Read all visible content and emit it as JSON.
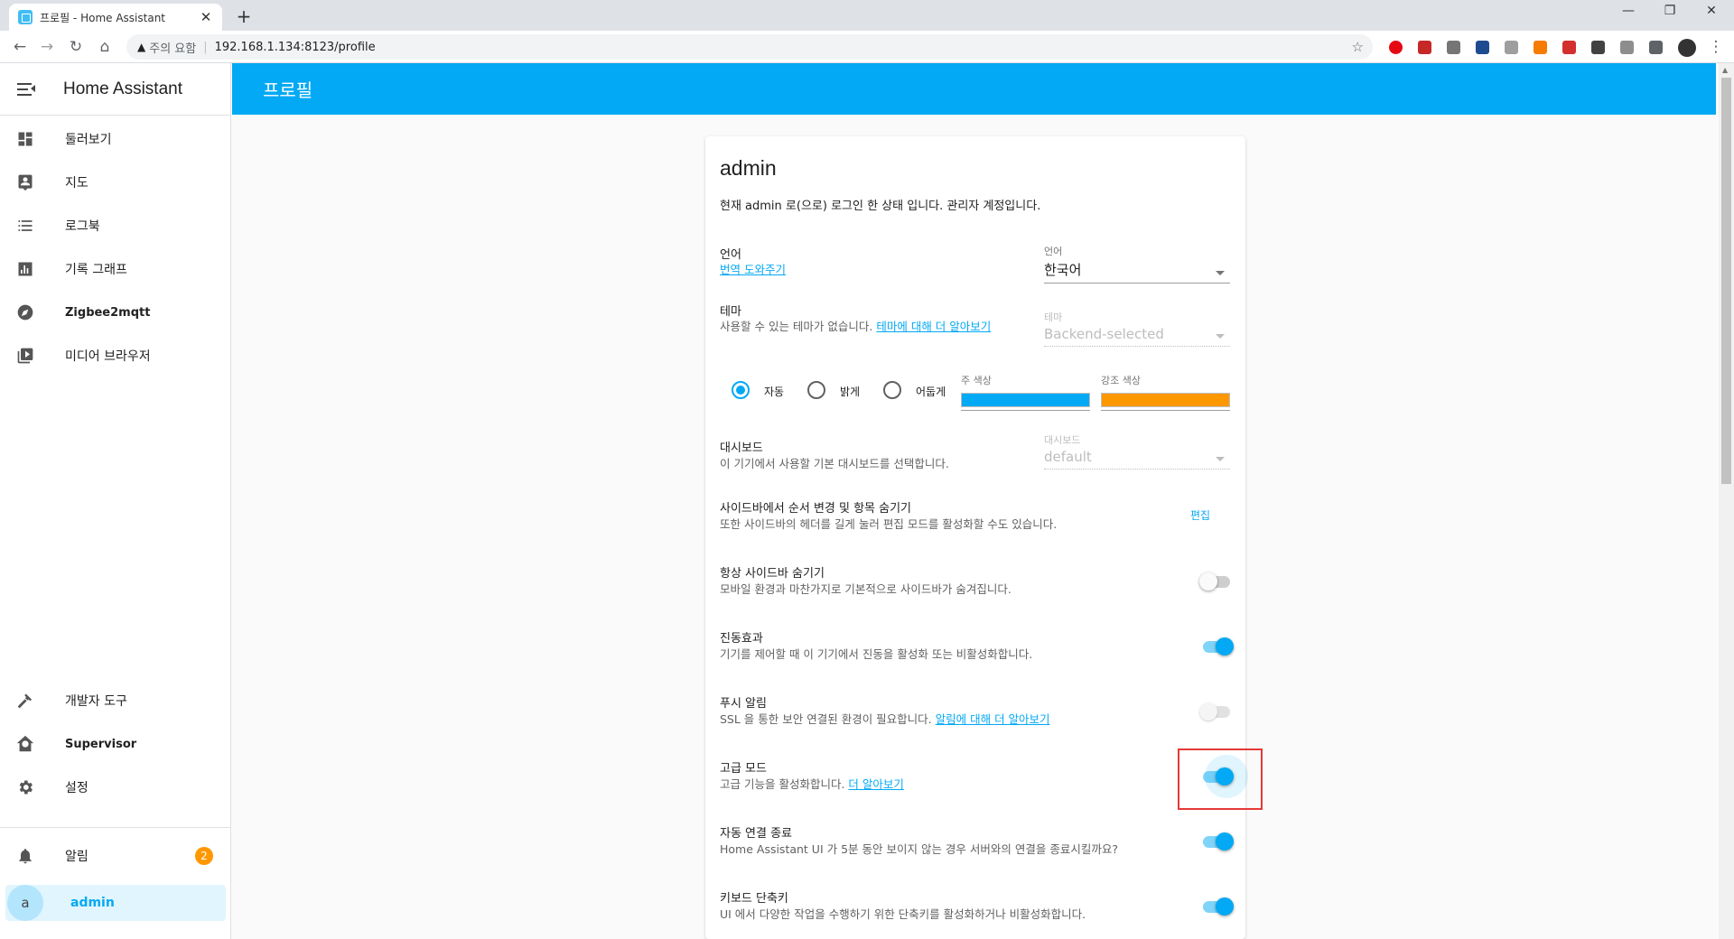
{
  "browser": {
    "tab_title": "프로필 - Home Assistant",
    "tab_close": "✕",
    "new_tab": "+",
    "security_label": "주의 요함",
    "url": "192.168.1.134:8123/profile"
  },
  "sidebar": {
    "app_title": "Home Assistant",
    "items": [
      {
        "label": "둘러보기",
        "icon": "dashboard-icon"
      },
      {
        "label": "지도",
        "icon": "map-account-icon"
      },
      {
        "label": "로그북",
        "icon": "logbook-list-icon"
      },
      {
        "label": "기록 그래프",
        "icon": "chart-bar-icon"
      },
      {
        "label": "Zigbee2mqtt",
        "icon": "compass-icon"
      },
      {
        "label": "미디어 브라우저",
        "icon": "play-box-icon"
      }
    ],
    "bottom_items": [
      {
        "label": "개발자 도구",
        "icon": "hammer-icon"
      },
      {
        "label": "Supervisor",
        "icon": "supervisor-home-icon"
      },
      {
        "label": "설정",
        "icon": "gear-icon"
      }
    ],
    "notifications": {
      "label": "알림",
      "count": "2"
    },
    "user": {
      "initial": "a",
      "name": "admin"
    }
  },
  "header": {
    "title": "프로필"
  },
  "profile": {
    "username": "admin",
    "status": "현재 admin 로(으로) 로그인 한 상태 입니다. 관리자 계정입니다.",
    "language": {
      "title": "언어",
      "link": "번역 도와주기",
      "select_label": "언어",
      "select_value": "한국어"
    },
    "theme": {
      "title": "테마",
      "desc": "사용할 수 있는 테마가 없습니다. ",
      "link": "테마에 대해 더 알아보기",
      "select_label": "테마",
      "select_value": "Backend-selected",
      "modes": [
        {
          "label": "자동",
          "selected": true
        },
        {
          "label": "밝게",
          "selected": false
        },
        {
          "label": "어둡게",
          "selected": false
        }
      ],
      "primary_color_label": "주 색상",
      "primary_color": "#03a9f4",
      "accent_color_label": "강조 색상",
      "accent_color": "#ff9800"
    },
    "dashboard": {
      "title": "대시보드",
      "desc": "이 기기에서 사용할 기본 대시보드를 선택합니다.",
      "select_label": "대시보드",
      "select_value": "default"
    },
    "sidebar_order": {
      "title": "사이드바에서 순서 변경 및 항목 숨기기",
      "desc": "또한 사이드바의 헤더를 길게 눌러 편집 모드를 활성화할 수도 있습니다.",
      "edit_label": "편집"
    },
    "always_hide_sidebar": {
      "title": "항상 사이드바 숨기기",
      "desc": "모바일 환경과 마찬가지로 기본적으로 사이드바가 숨겨집니다.",
      "enabled": false
    },
    "vibrate": {
      "title": "진동효과",
      "desc": "기기를 제어할 때 이 기기에서 진동을 활성화 또는 비활성화합니다.",
      "enabled": true
    },
    "push": {
      "title": "푸시 알림",
      "desc": "SSL 을 통한 보안 연결된 환경이 필요합니다. ",
      "link": "알림에 대해 더 알아보기",
      "enabled": false
    },
    "advanced": {
      "title": "고급 모드",
      "desc": "고급 기능을 활성화합니다. ",
      "link": "더 알아보기",
      "enabled": true
    },
    "auto_close": {
      "title": "자동 연결 종료",
      "desc": "Home Assistant UI 가 5분 동안 보이지 않는 경우 서버와의 연결을 종료시킬까요?",
      "enabled": true
    },
    "shortcuts": {
      "title": "키보드 단축키",
      "desc": "UI 에서 다양한 작업을 수행하기 위한 단축키를 활성화하거나 비활성화합니다.",
      "enabled": true
    }
  }
}
